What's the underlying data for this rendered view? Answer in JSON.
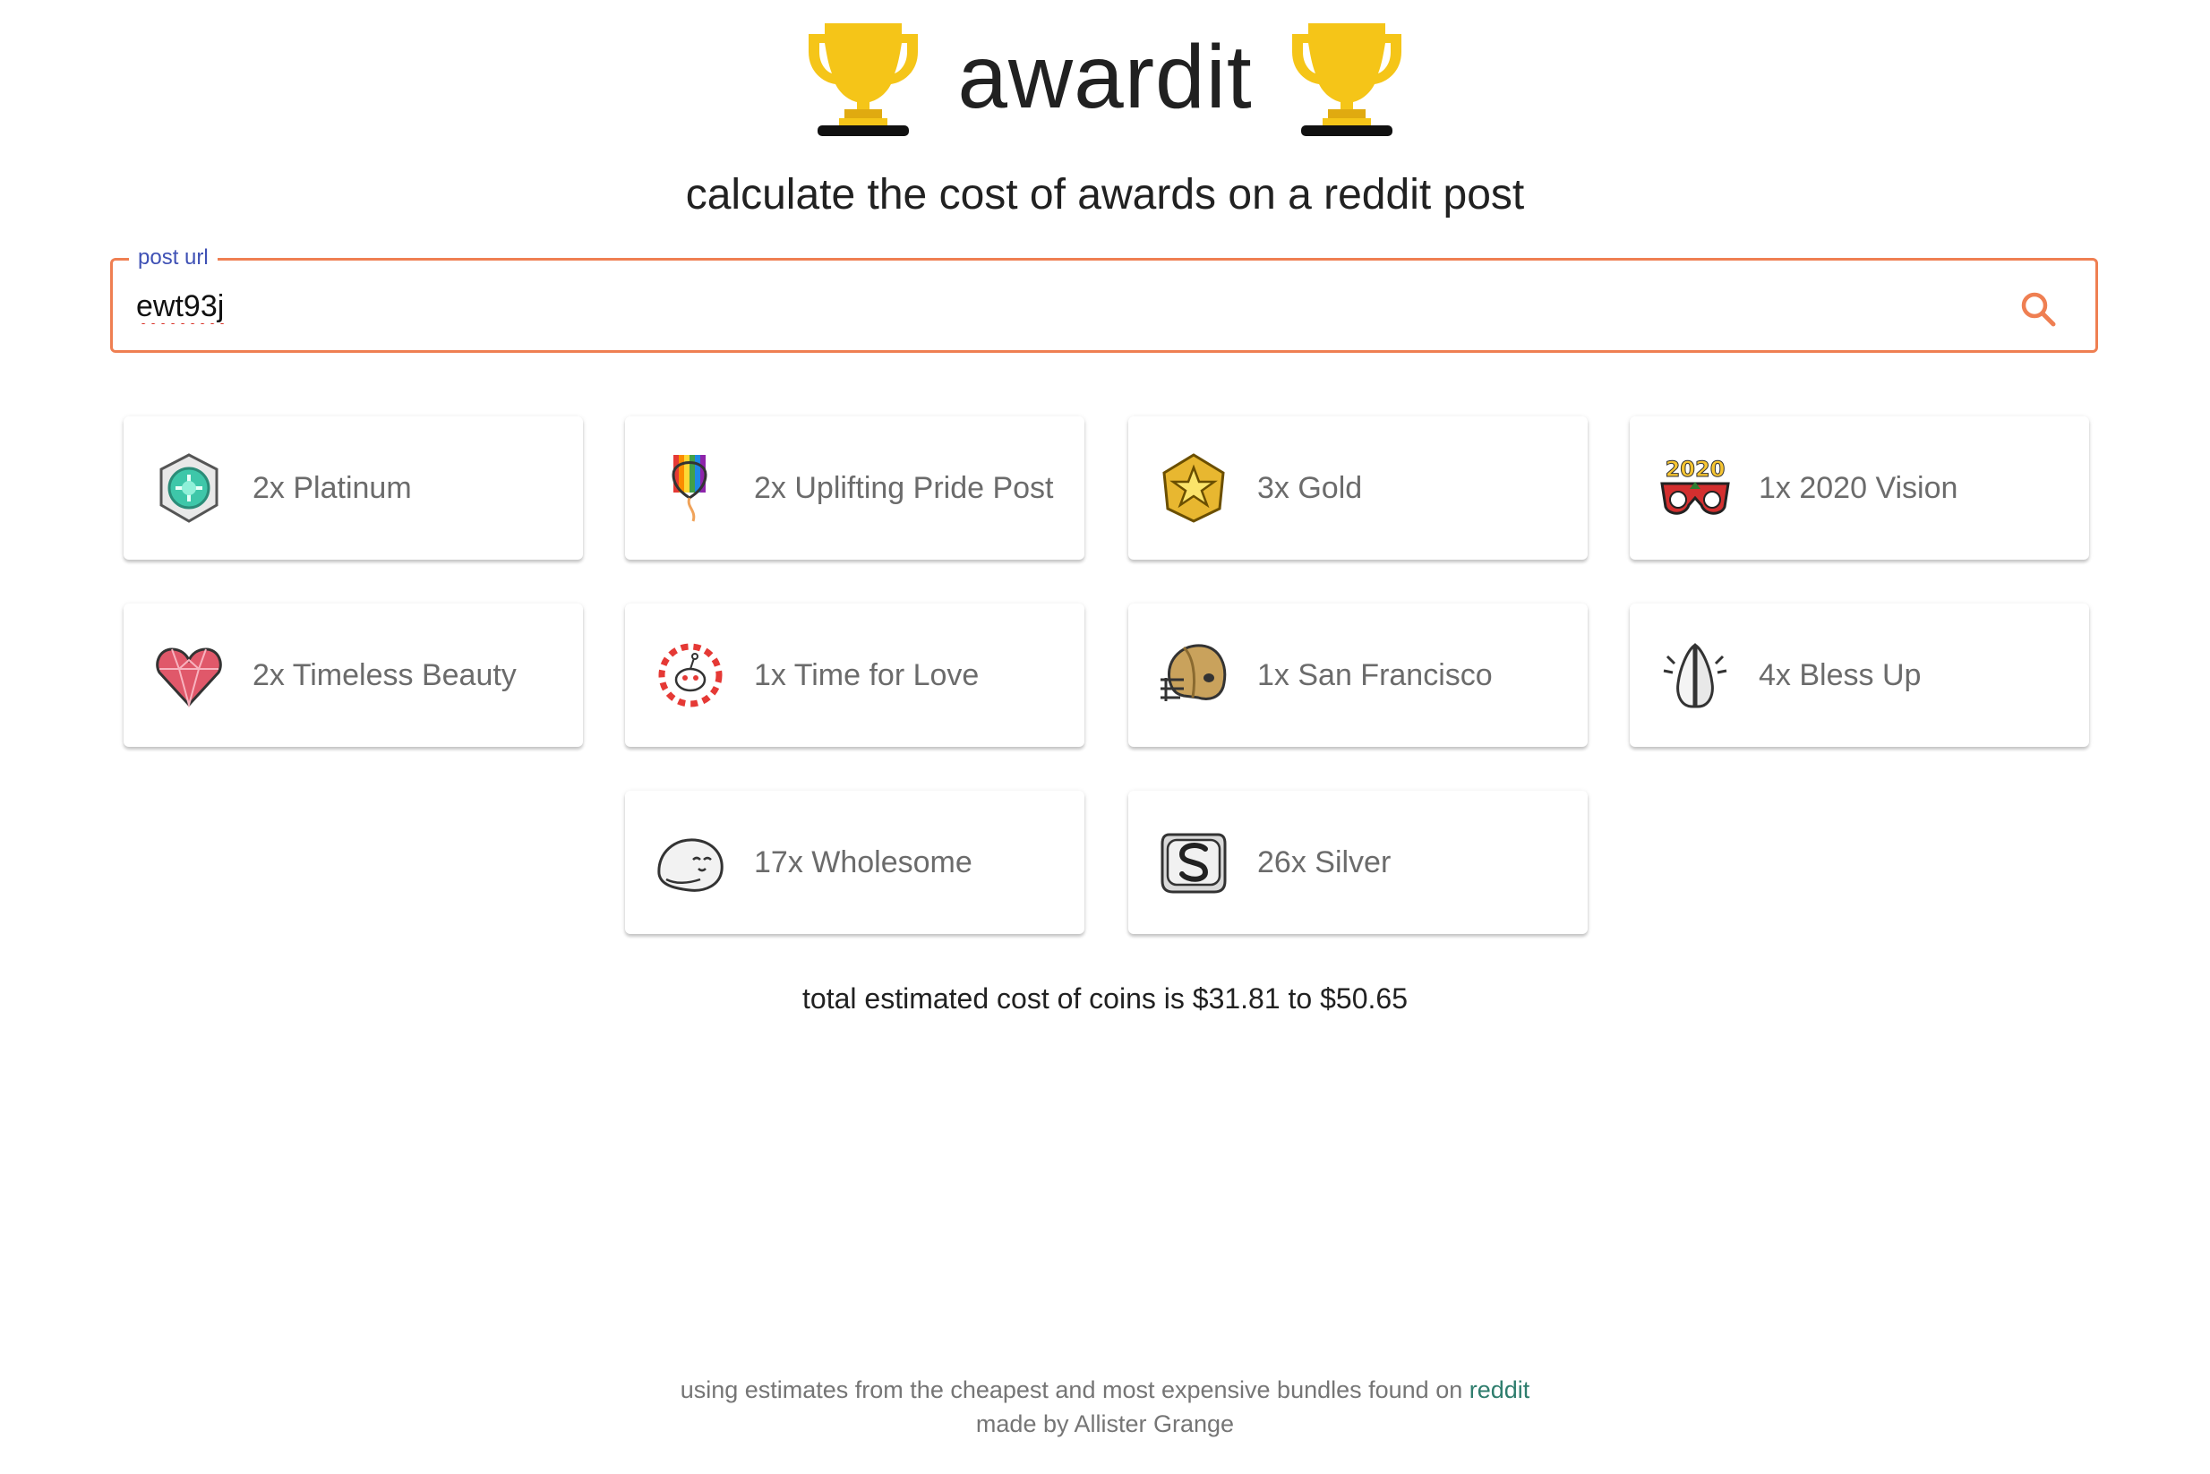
{
  "header": {
    "title": "awardit",
    "subtitle": "calculate the cost of awards on a reddit post",
    "trophy_icon": "trophy-icon"
  },
  "search": {
    "label": "post url",
    "value": "ewt93j",
    "icon": "search-icon",
    "accent_color": "#ef7f52",
    "label_color": "#3f51b5"
  },
  "awards": [
    {
      "label": "2x Platinum",
      "icon": "platinum-award-icon"
    },
    {
      "label": "2x Uplifting Pride Post",
      "icon": "pride-balloon-icon"
    },
    {
      "label": "3x Gold",
      "icon": "gold-award-icon"
    },
    {
      "label": "1x 2020 Vision",
      "icon": "2020-glasses-icon"
    },
    {
      "label": "2x Timeless Beauty",
      "icon": "heart-gem-icon"
    },
    {
      "label": "1x Time for Love",
      "icon": "snoo-hearts-icon"
    },
    {
      "label": "1x San Francisco",
      "icon": "football-helmet-icon"
    },
    {
      "label": "4x Bless Up",
      "icon": "praying-hands-icon"
    },
    {
      "label": "17x Wholesome",
      "icon": "wholesome-seal-icon"
    },
    {
      "label": "26x Silver",
      "icon": "silver-award-icon"
    }
  ],
  "total": "total estimated cost of coins is $31.81 to $50.65",
  "footer": {
    "line1_prefix": "using estimates from the cheapest and most expensive bundles found on ",
    "line1_link": "reddit",
    "line2": "made by Allister Grange"
  }
}
